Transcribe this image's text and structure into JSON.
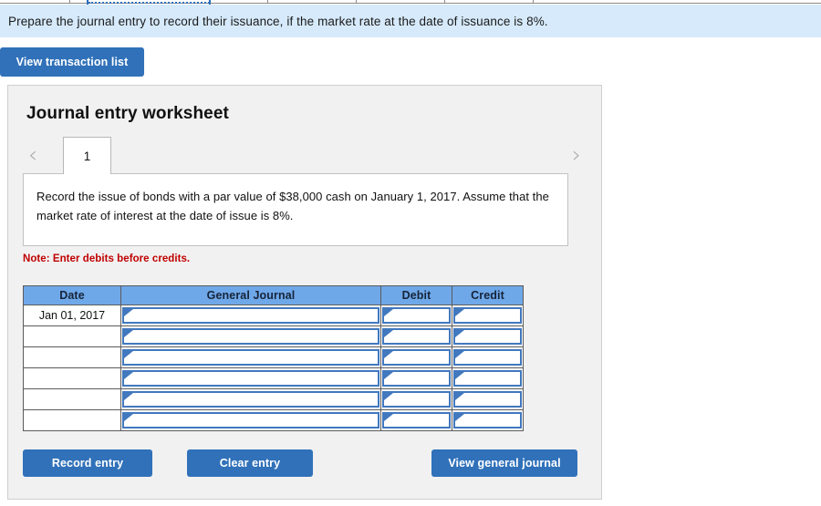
{
  "banner": {
    "text": "Prepare the journal entry to record their issuance, if the market rate at the date of issuance is 8%."
  },
  "toolbar": {
    "view_transaction_list_label": "View transaction list"
  },
  "worksheet": {
    "title": "Journal entry worksheet",
    "prev_arrow": "‹",
    "next_arrow": "›",
    "tabs": [
      {
        "label": "1",
        "active": true
      }
    ],
    "description": "Record the issue of bonds with a par value of $38,000 cash on January 1, 2017. Assume that the market rate of interest at the date of issue is 8%.",
    "note": "Note: Enter debits before credits."
  },
  "journal_table": {
    "headers": [
      "Date",
      "General Journal",
      "Debit",
      "Credit"
    ],
    "rows": [
      {
        "date": "Jan 01, 2017",
        "general_journal": "",
        "debit": "",
        "credit": ""
      },
      {
        "date": "",
        "general_journal": "",
        "debit": "",
        "credit": ""
      },
      {
        "date": "",
        "general_journal": "",
        "debit": "",
        "credit": ""
      },
      {
        "date": "",
        "general_journal": "",
        "debit": "",
        "credit": ""
      },
      {
        "date": "",
        "general_journal": "",
        "debit": "",
        "credit": ""
      },
      {
        "date": "",
        "general_journal": "",
        "debit": "",
        "credit": ""
      }
    ]
  },
  "actions": {
    "record_entry_label": "Record entry",
    "clear_entry_label": "Clear entry",
    "view_general_journal_label": "View general journal"
  },
  "colors": {
    "banner_bg": "#d6eafb",
    "button_blue": "#3071b9",
    "table_header_blue": "#6fa8e8",
    "input_border_blue": "#4178be",
    "note_red": "#c00000",
    "card_bg": "#f1f1f1"
  }
}
